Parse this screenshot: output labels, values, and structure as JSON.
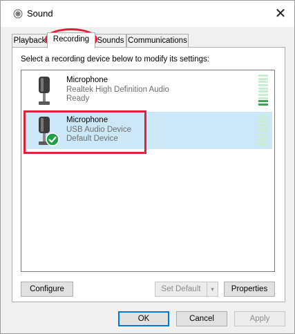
{
  "window": {
    "title": "Sound",
    "close_glyph": "✕"
  },
  "tabs": [
    {
      "label": "Playback"
    },
    {
      "label": "Recording"
    },
    {
      "label": "Sounds"
    },
    {
      "label": "Communications"
    }
  ],
  "active_tab": "Recording",
  "instruction": "Select a recording device below to modify its settings:",
  "devices": [
    {
      "name": "Microphone",
      "driver": "Realtek High Definition Audio",
      "status": "Ready",
      "icon": "microphone-icon",
      "level_segments_on": 2,
      "level_segments_total": 10
    },
    {
      "name": "Microphone",
      "driver": "USB Audio Device",
      "status": "Default Device",
      "icon": "microphone-icon",
      "badge": "default-check-icon",
      "selected": true,
      "level_segments_on": 0,
      "level_segments_total": 10
    }
  ],
  "buttons": {
    "configure": "Configure",
    "set_default": "Set Default",
    "set_default_arrow": "▾",
    "properties": "Properties",
    "ok": "OK",
    "cancel": "Cancel",
    "apply": "Apply"
  },
  "colors": {
    "selection": "#cce8f8",
    "annotation_red": "#d9243c",
    "level_active": "#3aa655",
    "default_badge": "#1f9e48"
  }
}
